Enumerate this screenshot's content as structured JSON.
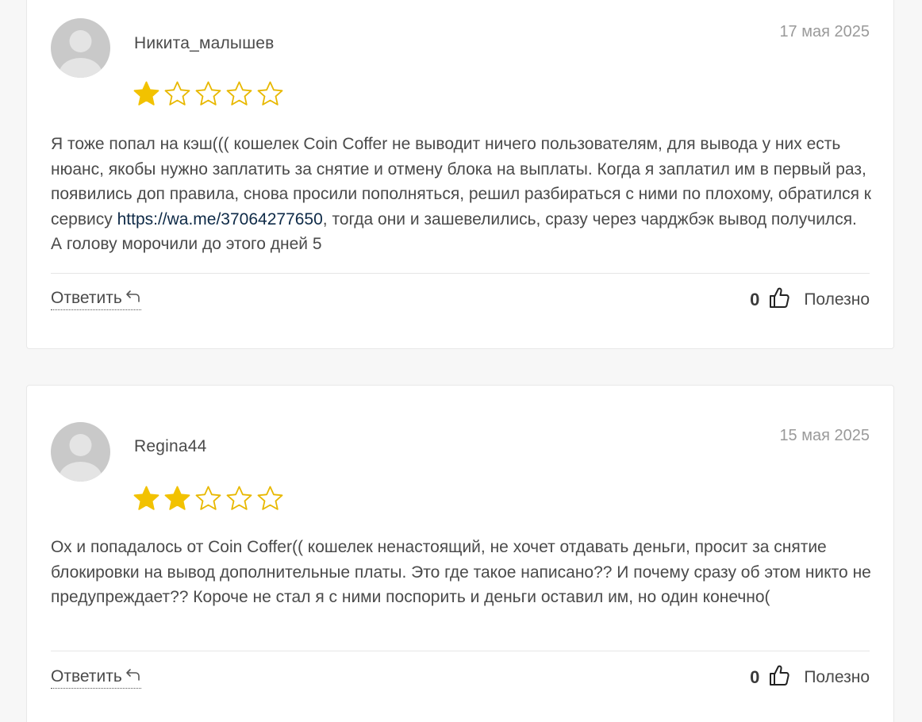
{
  "reviews": [
    {
      "author": "Никита_малышев",
      "date": "17 мая 2025",
      "rating": 1,
      "max_rating": 5,
      "text_before_link": "Я тоже попал на кэш((( кошелек Coin Coffer не выводит ничего пользователям, для вывода у них есть нюанс, якобы нужно заплатить за снятие и отмену блока на выплаты. Когда я заплатил им в первый раз, появились доп правила, снова просили пополняться, решил разбираться с ними по плохому, обратился к сервису ",
      "link": "https://wa.me/37064277650",
      "text_after_link": ", тогда они и зашевелились, сразу через чарджбэк вывод получился. А голову морочили до этого дней 5",
      "reply_label": "Ответить",
      "useful_count": "0",
      "useful_label": "Полезно"
    },
    {
      "author": "Regina44",
      "date": "15 мая 2025",
      "rating": 2,
      "max_rating": 5,
      "text": "Ох и попадалось от Coin Coffer(( кошелек ненастоящий, не хочет отдавать деньги, просит за снятие блокировки на вывод дополнительные платы. Это где такое написано?? И почему сразу об этом никто не предупреждает?? Короче не стал я с ними поспорить и деньги оставил им, но один конечно(",
      "reply_label": "Ответить",
      "useful_count": "0",
      "useful_label": "Полезно"
    }
  ],
  "colors": {
    "star_filled": "#f2c200",
    "star_outline": "#e8b800",
    "link": "#0e2a47",
    "date": "#9a9a9a",
    "card_border": "#e8e8e8"
  },
  "icons": {
    "avatar": "default-user-avatar",
    "reply": "reply-arrow-icon",
    "like": "thumbs-up-icon",
    "star": "star-icon"
  }
}
